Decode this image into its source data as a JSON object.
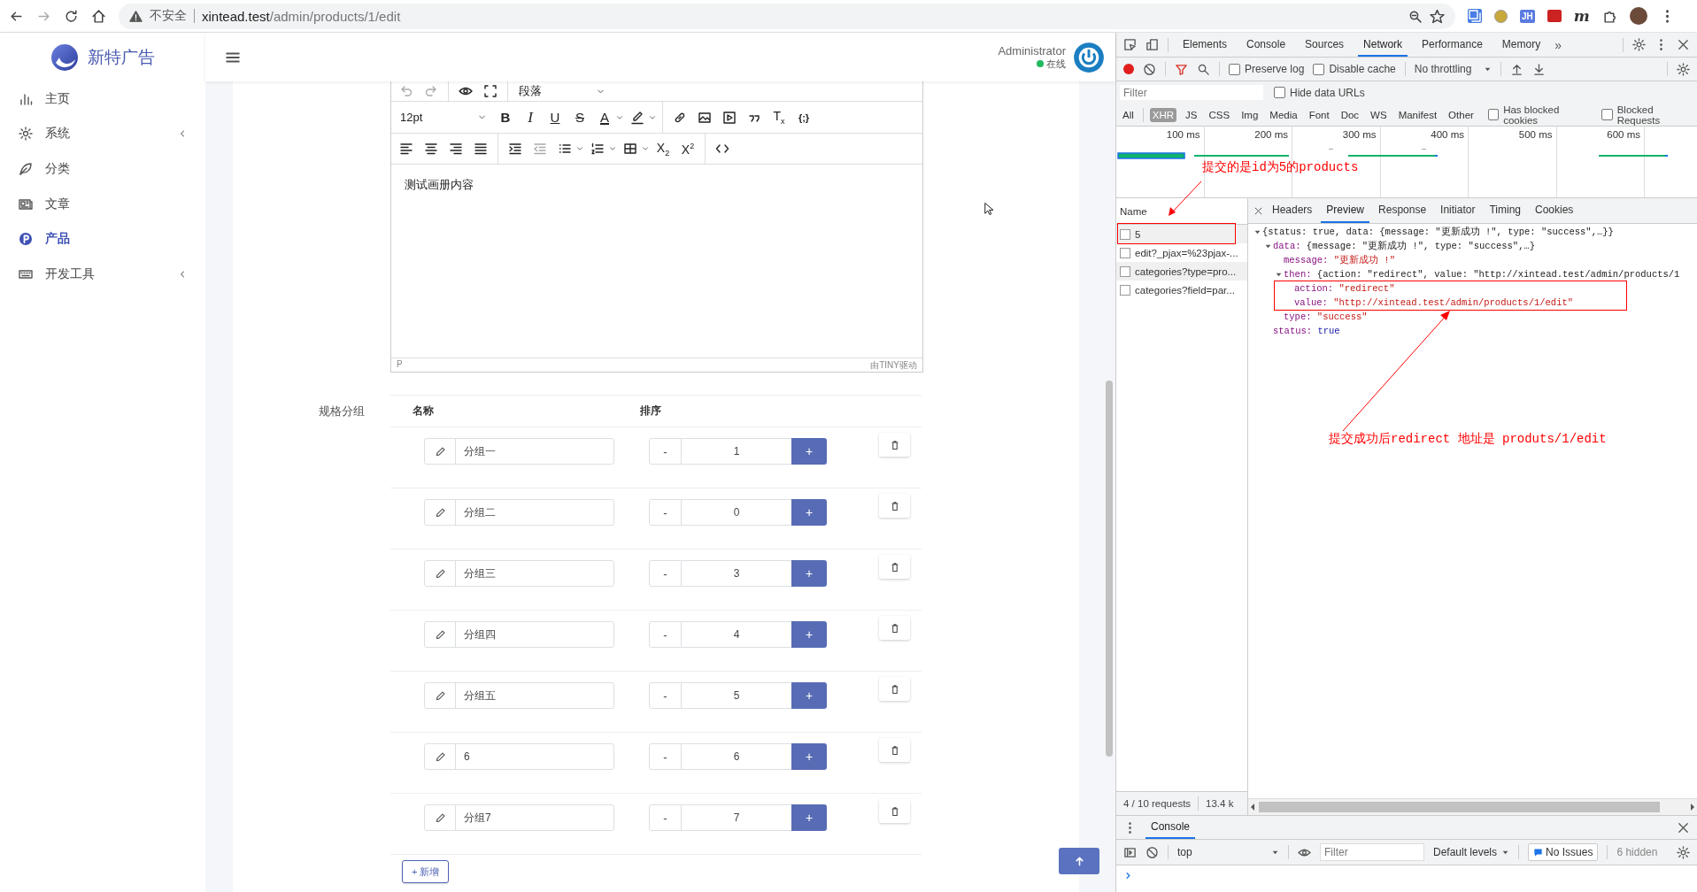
{
  "browser": {
    "security": "不安全",
    "url_host": "xintead.test",
    "url_path": "/admin/products/1/edit",
    "extension_badges": [
      {
        "kind": "jh",
        "text": "JH"
      },
      {
        "kind": "m",
        "text": "m"
      }
    ]
  },
  "sidebar": {
    "brand": "新特广告",
    "items": [
      {
        "label": "主页",
        "kind": "chart",
        "selected": false,
        "has_submenu": false
      },
      {
        "label": "系统",
        "kind": "gear",
        "selected": false,
        "has_submenu": true
      },
      {
        "label": "分类",
        "kind": "leaf",
        "selected": false,
        "has_submenu": false
      },
      {
        "label": "文章",
        "kind": "news",
        "selected": false,
        "has_submenu": false
      },
      {
        "label": "产品",
        "kind": "product",
        "selected": true,
        "has_submenu": false
      },
      {
        "label": "开发工具",
        "kind": "keyboard",
        "selected": false,
        "has_submenu": true
      }
    ]
  },
  "header": {
    "user": "Administrator",
    "status": "在线"
  },
  "editor": {
    "toolbar_rows": [
      [
        {
          "kind": "undo",
          "disabled": true
        },
        {
          "kind": "redo",
          "disabled": true
        },
        {
          "kind": "sep"
        },
        {
          "kind": "preview",
          "disabled": false
        },
        {
          "kind": "fullscreen",
          "disabled": false
        },
        {
          "kind": "sep"
        },
        {
          "kind": "select",
          "value": "段落",
          "disabled": false
        }
      ],
      [
        {
          "kind": "select",
          "value": "12pt",
          "disabled": false
        },
        {
          "kind": "bold",
          "glyph": "B",
          "disabled": false
        },
        {
          "kind": "italic",
          "glyph": "I",
          "disabled": false
        },
        {
          "kind": "underline",
          "glyph": "U",
          "disabled": false
        },
        {
          "kind": "strikethrough",
          "glyph": "S",
          "disabled": false
        },
        {
          "kind": "text-color",
          "glyph": "A",
          "has_menu": true,
          "disabled": false
        },
        {
          "kind": "highlight",
          "has_menu": true,
          "disabled": false
        },
        {
          "kind": "sep"
        },
        {
          "kind": "link",
          "disabled": false
        },
        {
          "kind": "image",
          "disabled": false
        },
        {
          "kind": "media",
          "disabled": false
        },
        {
          "kind": "quote",
          "disabled": false
        },
        {
          "kind": "remove-format",
          "glyph": "T$_{x}$",
          "disabled": false
        },
        {
          "kind": "code-sample",
          "glyph": "{;}",
          "disabled": false
        }
      ],
      [
        {
          "kind": "align-left",
          "disabled": false
        },
        {
          "kind": "align-center",
          "disabled": false
        },
        {
          "kind": "align-right",
          "disabled": false
        },
        {
          "kind": "justify",
          "disabled": false
        },
        {
          "kind": "sep"
        },
        {
          "kind": "indent",
          "disabled": false
        },
        {
          "kind": "outdent",
          "disabled": true
        },
        {
          "kind": "bullet-list",
          "has_menu": true,
          "disabled": false
        },
        {
          "kind": "number-list",
          "has_menu": true,
          "disabled": false
        },
        {
          "kind": "table",
          "has_menu": true,
          "disabled": false
        },
        {
          "kind": "subscript",
          "glyph": "X$_{2}$",
          "disabled": false
        },
        {
          "kind": "superscript",
          "glyph": "X$^{2}$",
          "disabled": false
        },
        {
          "kind": "sep"
        },
        {
          "kind": "source-code",
          "disabled": false
        }
      ]
    ],
    "content": "测试画册内容",
    "path": "P",
    "branding": "由TINY驱动"
  },
  "spec_group": {
    "label": "规格分组",
    "columns": [
      "名称",
      "排序"
    ],
    "rows": [
      {
        "name": "分组一",
        "order": "1"
      },
      {
        "name": "分组二",
        "order": "0"
      },
      {
        "name": "分组三",
        "order": "3"
      },
      {
        "name": "分组四",
        "order": "4"
      },
      {
        "name": "分组五",
        "order": "5"
      },
      {
        "name": "6",
        "order": "6"
      },
      {
        "name": "分组7",
        "order": "7"
      }
    ],
    "minus": "-",
    "plus": "+",
    "add_button": "+ 新增"
  },
  "devtools": {
    "panel_tabs": [
      {
        "label": "Elements",
        "selected": false
      },
      {
        "label": "Console",
        "selected": false
      },
      {
        "label": "Sources",
        "selected": false
      },
      {
        "label": "Network",
        "selected": true
      },
      {
        "label": "Performance",
        "selected": false
      },
      {
        "label": "Memory",
        "selected": false
      }
    ],
    "more": "»",
    "preserve_log": {
      "label": "Preserve log",
      "checked": false
    },
    "disable_cache": {
      "label": "Disable cache",
      "checked": false
    },
    "throttling": "No throttling",
    "filter_placeholder": "Filter",
    "hide_data_urls": {
      "label": "Hide data URLs",
      "checked": false
    },
    "type_filters": [
      {
        "label": "All",
        "selected": false
      },
      {
        "label": "XHR",
        "selected": true
      },
      {
        "label": "JS",
        "selected": false
      },
      {
        "label": "CSS",
        "selected": false
      },
      {
        "label": "Img",
        "selected": false
      },
      {
        "label": "Media",
        "selected": false
      },
      {
        "label": "Font",
        "selected": false
      },
      {
        "label": "Doc",
        "selected": false
      },
      {
        "label": "WS",
        "selected": false
      },
      {
        "label": "Manifest",
        "selected": false
      },
      {
        "label": "Other",
        "selected": false
      }
    ],
    "blocked_cookies": {
      "label": "Has blocked cookies",
      "checked": false
    },
    "blocked_requests": {
      "label": "Blocked Requests",
      "checked": false
    },
    "timeline_ticks": [
      "100 ms",
      "200 ms",
      "300 ms",
      "400 ms",
      "500 ms",
      "600 ms"
    ],
    "requests": {
      "header": "Name",
      "items": [
        {
          "name": "5"
        },
        {
          "name": "edit?_pjax=%23pjax-..."
        },
        {
          "name": "categories?type=pro..."
        },
        {
          "name": "categories?field=par..."
        }
      ],
      "summary": "4 / 10 requests",
      "size": "13.4 k"
    },
    "detail_tabs": [
      {
        "label": "Headers",
        "selected": false
      },
      {
        "label": "Preview",
        "selected": true
      },
      {
        "label": "Response",
        "selected": false
      },
      {
        "label": "Initiator",
        "selected": false
      },
      {
        "label": "Timing",
        "selected": false
      },
      {
        "label": "Cookies",
        "selected": false
      }
    ],
    "preview": [
      {
        "value": "{status: true, data: {message: \"更新成功 !\", type: \"success\",…}}",
        "kind": "object",
        "expanded": true,
        "children": [
          {
            "key": "data:",
            "value": "{message: \"更新成功 !\", type: \"success\",…}",
            "kind": "object",
            "expanded": true,
            "children": [
              {
                "key": "message:",
                "value": "\"更新成功 !\"",
                "kind": "string"
              },
              {
                "key": "then:",
                "value": "{action: \"redirect\", value: \"http://xintead.test/admin/products/1",
                "kind": "object",
                "expanded": true,
                "children": [
                  {
                    "key": "action:",
                    "value": "\"redirect\"",
                    "kind": "string"
                  },
                  {
                    "key": "value:",
                    "value": "\"http://xintead.test/admin/products/1/edit\"",
                    "kind": "string"
                  }
                ]
              },
              {
                "key": "type:",
                "value": "\"success\"",
                "kind": "string"
              }
            ]
          },
          {
            "key": "status:",
            "value": "true",
            "kind": "boolean"
          }
        ]
      }
    ],
    "console": {
      "tab": "Console",
      "context": "top",
      "filter_placeholder": "Filter",
      "levels": "Default levels",
      "issues": "No Issues",
      "hidden": "6 hidden"
    }
  },
  "annotations": [
    {
      "text": "提交的是id为5的products"
    },
    {
      "text": "提交成功后redirect 地址是 produts/1/edit"
    }
  ]
}
